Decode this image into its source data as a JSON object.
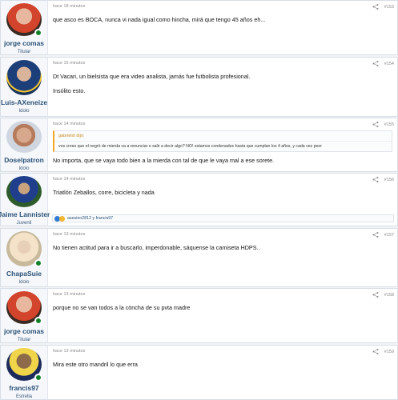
{
  "posts": [
    {
      "num": "#153",
      "time": "hace 18 minutos",
      "user": "jorge comas",
      "title": "Titular",
      "body": [
        "que asco es BOCA, nunca vi nada igual como hincha, mirá que tengo 45 años eh..."
      ]
    },
    {
      "num": "#154",
      "time": "hace 15 minutos",
      "user": "Luis-AXeneize",
      "title": "Idolo",
      "body": [
        "Dt Vacari, un bielsista que era video analista, jamás fue futbolista profesional.",
        "Insólito esto."
      ]
    },
    {
      "num": "#155",
      "time": "hace 14 minutos",
      "user": "Doselpatron",
      "title": "Idolo",
      "quote_author": "gabrielst dijo:",
      "quote_text": "vos crees que el negrö de mierda va a renunciar o salir a decir algo? NO! estamos condenados hasta que cumplan los 4 años, y cada vez peor",
      "body": [
        "No importa, que se vaya todo bien a la mierda con tal de que le vaya mal a ese sorete."
      ]
    },
    {
      "num": "#156",
      "time": "hace 14 minutos",
      "user": "Jaime Lannister",
      "title": "Juvenil",
      "body": [
        "Triatlón Zeballos, corre, bicicleta y nada"
      ],
      "reactions": "asesino2812 y francis97"
    },
    {
      "num": "#157",
      "time": "hace 13 minutos",
      "user": "ChapaSuie",
      "title": "Idolo",
      "body": [
        "No tienen actitud para ir a buscarlo, imperdonable, sáquense la camiseta HDPS.."
      ]
    },
    {
      "num": "#158",
      "time": "hace 13 minutos",
      "user": "jorge comas",
      "title": "Titular",
      "body": [
        "porque no se van todos a la cöncha de su pvta madre"
      ]
    },
    {
      "num": "#159",
      "time": "hace 13 minutos",
      "user": "francis97",
      "title": "Estrella",
      "body": [
        "Mira este otro mandril lo que erra"
      ]
    }
  ],
  "colors": {
    "username": "#2b5278",
    "online": "#127f2a",
    "quote_accent": "#f5a623"
  },
  "icons": {
    "share": "share-icon",
    "online": "online-indicator-icon",
    "reaction": "like-icon"
  }
}
